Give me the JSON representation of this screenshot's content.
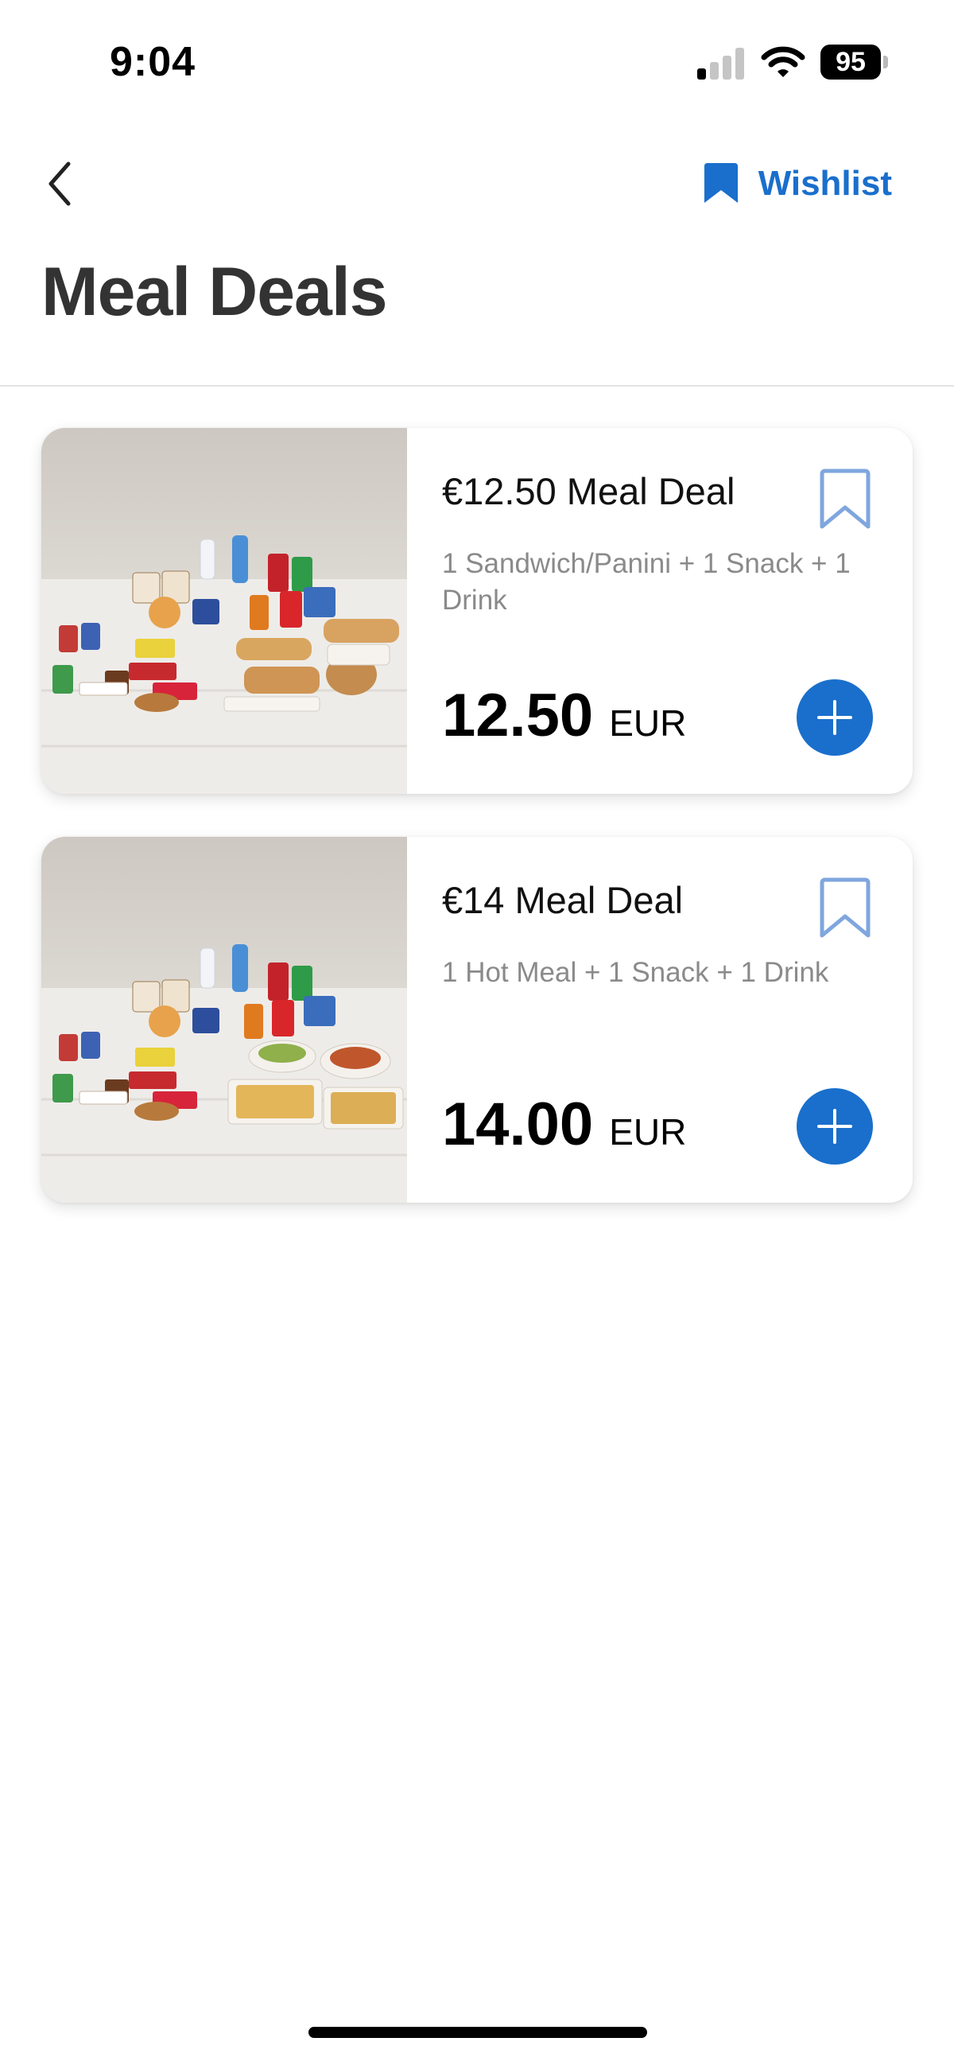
{
  "status_bar": {
    "time": "9:04",
    "battery": "95"
  },
  "nav": {
    "back_icon": "chevron-left-icon",
    "wishlist_label": "Wishlist",
    "wishlist_icon": "bookmark-filled-icon"
  },
  "page": {
    "title": "Meal Deals"
  },
  "deals": [
    {
      "title": "€12.50 Meal Deal",
      "description": "1 Sandwich/Panini + 1 Snack + 1 Drink",
      "price": "12.50",
      "currency": "EUR"
    },
    {
      "title": "€14 Meal Deal",
      "description": "1 Hot Meal + 1 Snack + 1 Drink",
      "price": "14.00",
      "currency": "EUR"
    }
  ],
  "colors": {
    "accent": "#1a6fcc",
    "bookmark_outline": "#7fa6de",
    "muted_text": "#8a8a8a"
  }
}
